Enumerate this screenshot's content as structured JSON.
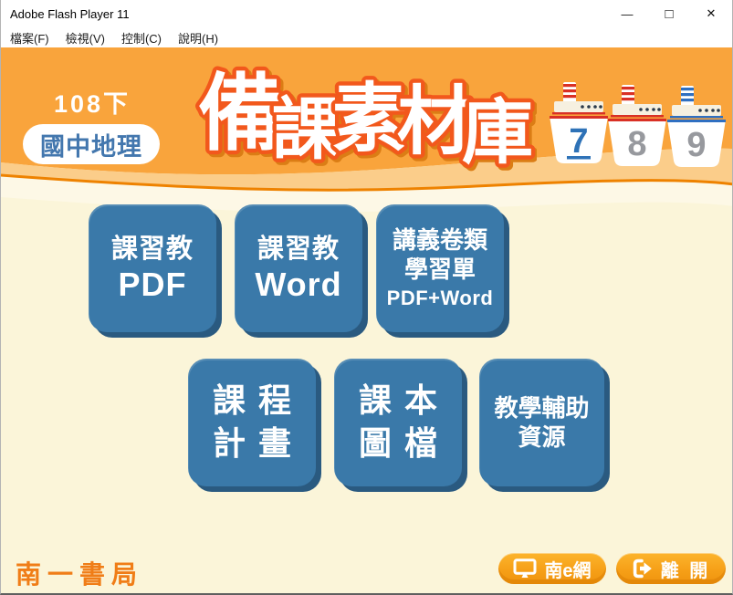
{
  "window": {
    "title": "Adobe Flash Player 11",
    "menu_items": [
      {
        "label": "檔案(F)"
      },
      {
        "label": "檢視(V)"
      },
      {
        "label": "控制(C)"
      },
      {
        "label": "說明(H)"
      }
    ],
    "controls": {
      "minimize": "—",
      "maximize": "□",
      "close": "✕"
    }
  },
  "header": {
    "semester_label": "108下",
    "subject_label": "國中地理",
    "main_title": {
      "text": "備課素材庫",
      "chars": [
        "備",
        "課",
        "素",
        "材",
        "庫"
      ]
    },
    "grade_tabs": [
      {
        "number": "7",
        "active": true,
        "stripe": "#d93025"
      },
      {
        "number": "8",
        "active": false,
        "stripe": "#d93025"
      },
      {
        "number": "9",
        "active": false,
        "stripe": "#2f6fc1"
      }
    ]
  },
  "tiles": [
    {
      "lines": [
        "課習教",
        "PDF"
      ]
    },
    {
      "lines": [
        "課習教",
        "Word"
      ]
    },
    {
      "lines": [
        "講義卷類",
        "學習單",
        "PDF+Word"
      ]
    },
    {
      "lines": [
        "課程",
        "計畫"
      ]
    },
    {
      "lines": [
        "課本",
        "圖檔"
      ]
    },
    {
      "lines": [
        "教學輔助",
        "資源"
      ]
    }
  ],
  "footer": {
    "logo": "南一書局",
    "nane_label": "南e網",
    "exit_label": "離 開"
  },
  "colors": {
    "header_orange": "#f9a43c",
    "wave_band_light": "#fbcd8a",
    "wave_line_orange": "#ee8200",
    "body_cream": "#fbf5d9",
    "tile_blue": "#3a79a9",
    "tile_blue_shadow": "#2a5a80",
    "title_fill": "#ffffff",
    "title_outline": "#f2581c",
    "subject_blue": "#4377ae",
    "active_tab_blue": "#2e72b7",
    "inactive_tab_gray": "#97999e",
    "footer_button_orange": "#f6a018",
    "logo_orange": "#f07d17"
  }
}
